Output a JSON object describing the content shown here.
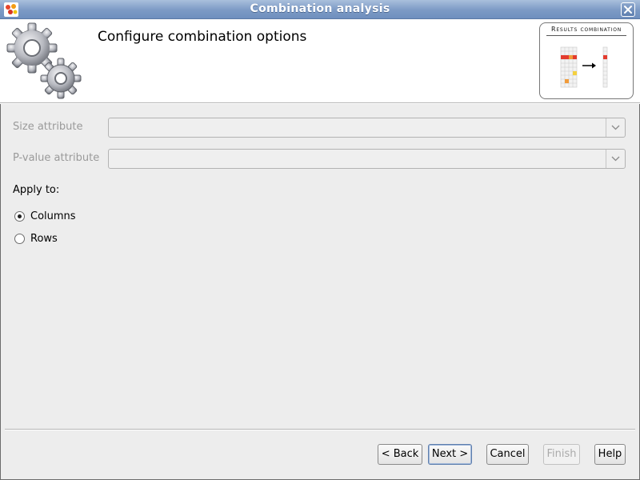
{
  "window": {
    "title": "Combination analysis",
    "app_icon": "app-logo-icon",
    "close_icon": "close-icon"
  },
  "header": {
    "title": "Configure combination options",
    "image_icon": "gears-icon",
    "thumbnail": {
      "label": "Results combination",
      "icon": "results-combination-diagram"
    }
  },
  "form": {
    "size_attribute": {
      "label": "Size attribute",
      "value": ""
    },
    "pvalue_attribute": {
      "label": "P-value attribute",
      "value": ""
    },
    "apply_to": {
      "label": "Apply to:",
      "options": [
        {
          "label": "Columns",
          "checked": true
        },
        {
          "label": "Rows",
          "checked": false
        }
      ]
    }
  },
  "buttons": {
    "back": "< Back",
    "next": "Next >",
    "cancel": "Cancel",
    "finish": "Finish",
    "help": "Help"
  },
  "colors": {
    "titlebar": "#7c9ac5",
    "highlight_red": "#e33b2e",
    "highlight_orange": "#f19b3a",
    "highlight_yellow": "#f4d03f"
  }
}
